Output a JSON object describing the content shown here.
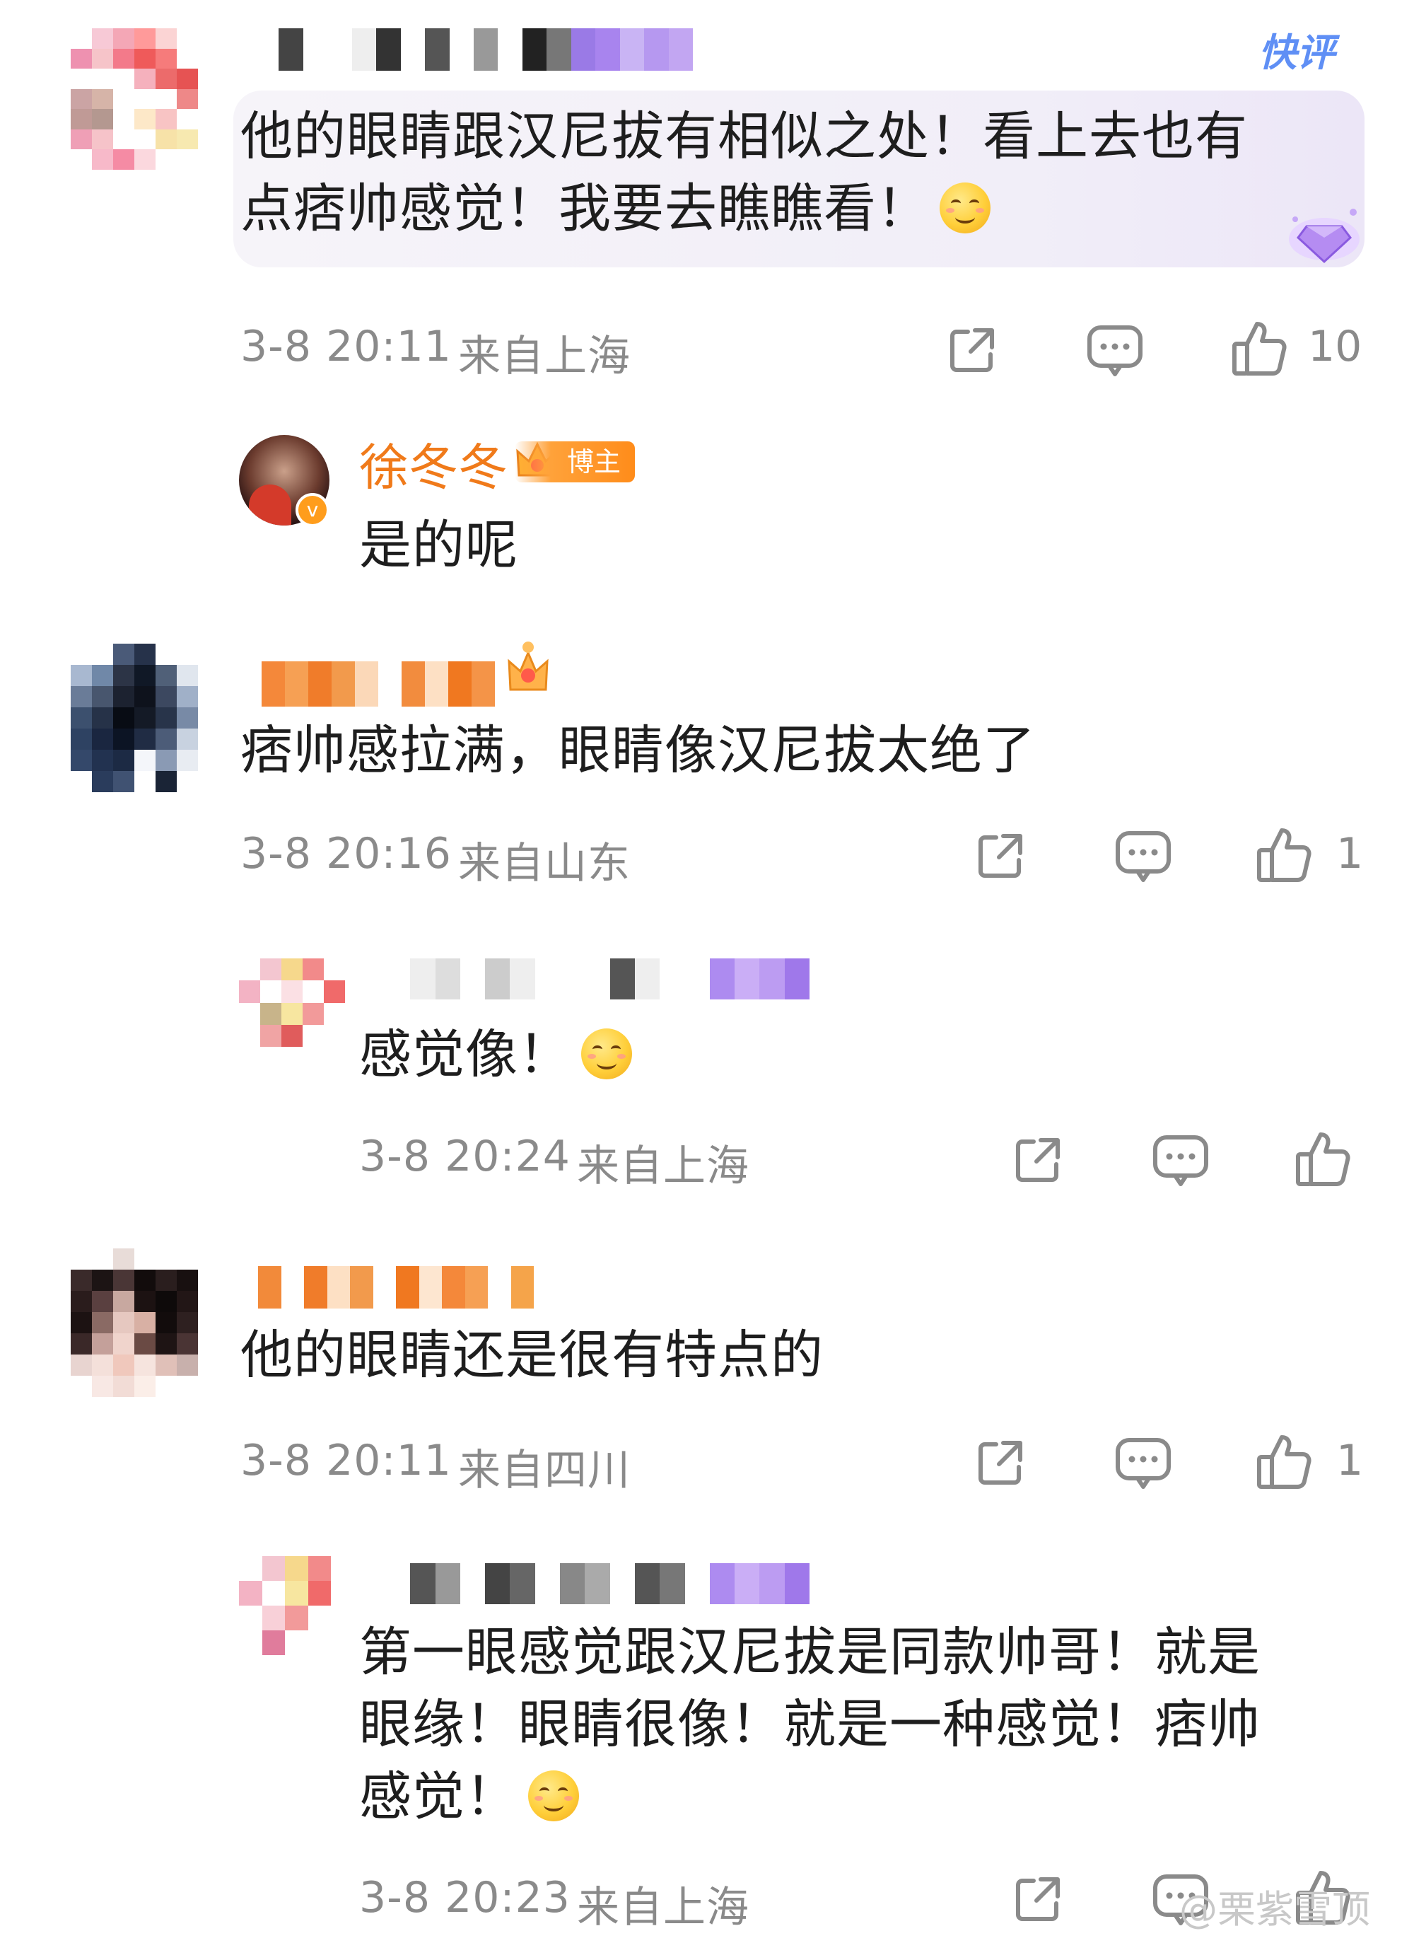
{
  "header": {
    "kuaiping_label": "快评"
  },
  "comments": [
    {
      "text_line1": "他的眼睛跟汉尼拔有相似之处！看上去也有",
      "text_line2": "点痞帅感觉！我要去瞧瞧看！",
      "time": "3-8 20:11",
      "location": "来自上海",
      "likes": "10"
    },
    {
      "blogger_name": "徐冬冬",
      "blogger_badge": "博主",
      "text": "是的呢"
    },
    {
      "text": "痞帅感拉满，眼睛像汉尼拔太绝了",
      "time": "3-8 20:16",
      "location": "来自山东",
      "likes": "1"
    },
    {
      "text": "感觉像！",
      "time": "3-8 20:24",
      "location": "来自上海"
    },
    {
      "text": "他的眼睛还是很有特点的",
      "time": "3-8 20:11",
      "location": "来自四川",
      "likes": "1"
    },
    {
      "text_line1": "第一眼感觉跟汉尼拔是同款帅哥！就是",
      "text_line2": "眼缘！眼睛很像！就是一种感觉！痞帅",
      "text_line3": "感觉！",
      "time": "3-8 20:23",
      "location": "来自上海"
    }
  ],
  "watermark": "@栗紫雪顶",
  "colors": {
    "meta_gray": "#8a8a8a",
    "blogger_orange": "#f07a1a",
    "kuaiping_blue": "#5f8ff5"
  }
}
